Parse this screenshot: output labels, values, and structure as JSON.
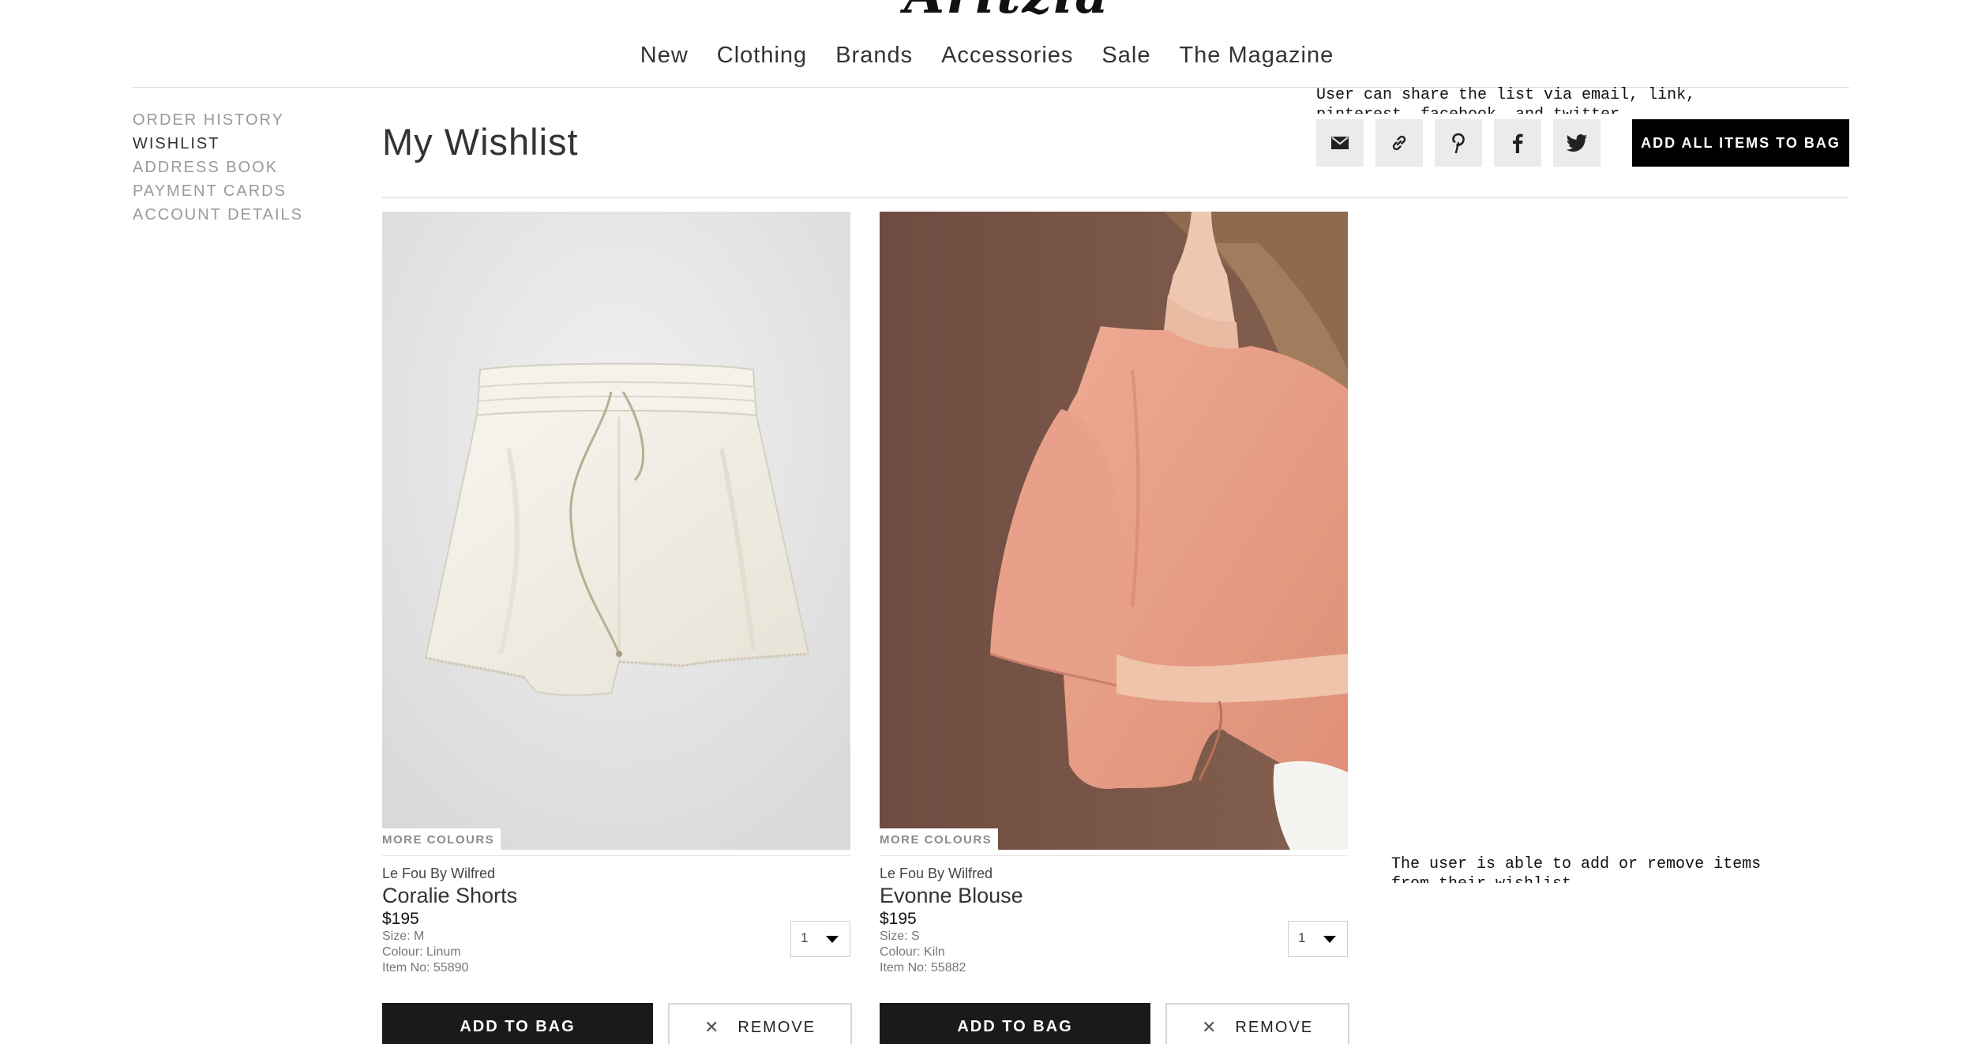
{
  "header": {
    "logo_text": "Aritzia",
    "nav": [
      "New",
      "Clothing",
      "Brands",
      "Accessories",
      "Sale",
      "The Magazine"
    ]
  },
  "sidebar": {
    "items": [
      {
        "label": "ORDER HISTORY",
        "active": false
      },
      {
        "label": "WISHLIST",
        "active": true
      },
      {
        "label": "ADDRESS BOOK",
        "active": false
      },
      {
        "label": "PAYMENT CARDS",
        "active": false
      },
      {
        "label": "ACCOUNT DETAILS",
        "active": false
      }
    ]
  },
  "main": {
    "title": "My Wishlist",
    "share_note": [
      "User can share the list via email, link,",
      "pinterest, facebook, and twitter"
    ],
    "share_icons": [
      "mail-icon",
      "link-icon",
      "pinterest-icon",
      "facebook-icon",
      "twitter-icon"
    ],
    "add_all_label": "ADD ALL ITEMS TO BAG",
    "remove_note": [
      "The user is able to add or remove items",
      "from their wishlist"
    ]
  },
  "products": [
    {
      "more_colours": "MORE COLOURS",
      "brand": "Le Fou By Wilfred",
      "name": "Coralie Shorts",
      "price": "$195",
      "size": "Size: M",
      "colour": "Colour: Linum",
      "item_no": "Item No: 55890",
      "qty": "1",
      "add_label": "ADD TO BAG",
      "remove_label": "REMOVE",
      "remove_symbol": "✕"
    },
    {
      "more_colours": "MORE COLOURS",
      "brand": "Le Fou By Wilfred",
      "name": "Evonne Blouse",
      "price": "$195",
      "size": "Size: S",
      "colour": "Colour: Kiln",
      "item_no": "Item No: 55882",
      "qty": "1",
      "add_label": "ADD TO BAG",
      "remove_label": "REMOVE",
      "remove_symbol": "✕"
    }
  ],
  "colors": {
    "accent_button": "#000000",
    "sidebar_inactive": "#9a9a9a",
    "blouse": "#e99d86",
    "backdrop_brown": "#7a574b"
  }
}
